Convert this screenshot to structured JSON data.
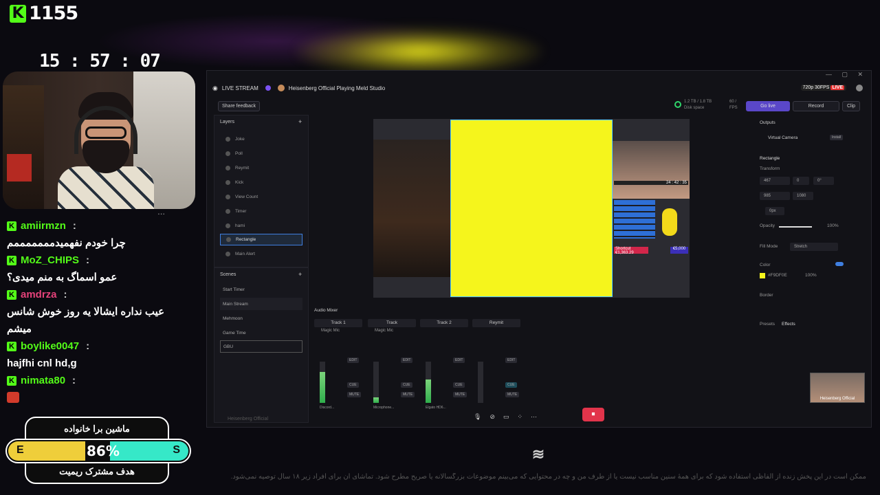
{
  "overlay": {
    "viewer_count": "1155",
    "clock": "15 : 57 : 07",
    "chat": [
      {
        "user": "amiirmzn",
        "message": "چرا خودم نفهمیدمممممممم"
      },
      {
        "user": "MoZ_CHIPS",
        "message": "عمو اسماگ به منم میدی؟"
      },
      {
        "user": "amdrza",
        "message": "عیب نداره ایشالا یه روز خوش شانس"
      },
      {
        "user": "boylike0047",
        "message": "hajfhi cnl hd,g"
      },
      {
        "user": "nimata80",
        "message": ""
      }
    ],
    "chat_continuation": "میشم",
    "goal": {
      "title": "ماشین برا خانواده",
      "subtitle": "هدف مشترک ریمیت",
      "left_label": "E",
      "right_label": "S",
      "percent_label": "86%",
      "progress": 0.86
    },
    "disclaimer": "ممکن است در این پخش زنده از الفاظی استفاده شود که برای همهٔ سنین مناسب نیست یا از طرف من و چه در محتوایی که می‌بینم موضوعات بزرگسالانه یا صریح مطرح شود. تماشای آن برای افراد زیر ۱۸ سال توصیه نمی‌شود."
  },
  "app": {
    "live_label": "LIVE STREAM",
    "window_title": "Heisenberg Official Playing Meld Studio",
    "quality": "720p 30FPS",
    "live_tag": "LIVE",
    "share_feedback": "Share feedback",
    "disk": "1.2 TB / 1.8 TB",
    "disk_label": "Disk space",
    "fps": "60 /",
    "fps_label": "FPS",
    "go_live": "Go live",
    "record": "Record",
    "clip": "Clip",
    "layers_title": "Layers",
    "layers": [
      "Joke",
      "Poll",
      "Reymit",
      "Kick",
      "View Count",
      "Timer",
      "hami",
      "Rectangle",
      "Main Alert"
    ],
    "scenes_title": "Scenes",
    "scenes": [
      "Start Timer",
      "Main Stream",
      "Mehmoon",
      "Game Time",
      "GBU"
    ],
    "outputs_title": "Outputs",
    "virtual_camera": "Virtual Camera",
    "install": "Install",
    "selected_title": "Rectangle",
    "transform_title": "Transform",
    "x_val": "467",
    "y_val": "0",
    "rot_val": "0°",
    "w_val": "985",
    "h_val": "1080",
    "radius_val": "0px",
    "opacity_label": "Opacity",
    "opacity_val": "100%",
    "fill_mode_label": "Fill Mode",
    "fill_mode_val": "Stretch",
    "color_label": "Color",
    "color_hex": "#F9DF0E",
    "color_pct": "100%",
    "border_label": "Border",
    "presets": "Presets",
    "effects": "Effects",
    "audio_mixer": "Audio Mixer",
    "tracks": [
      {
        "name": "Track 1",
        "source": "Magic Mic",
        "device": "Discord...",
        "level": 0.75
      },
      {
        "name": "Track",
        "source": "Magic Mic",
        "device": "Microphone...",
        "level": 0.15
      },
      {
        "name": "Track 2",
        "source": "",
        "device": "Elgato HD6...",
        "level": 0.55
      },
      {
        "name": "Reymit",
        "source": "",
        "device": "",
        "level": 0.0
      }
    ],
    "track_tags": [
      "EDIT",
      "CUE",
      "MUTE"
    ],
    "pip_name": "Heisenberg Official",
    "streamer_footer": "Heisenberg Official",
    "chart_canvas_labels": {
      "timer": "24 : 42 : 35",
      "shortcut": "Shortcut",
      "amount1": "€1,363.29",
      "amount2": "€5,000"
    }
  }
}
